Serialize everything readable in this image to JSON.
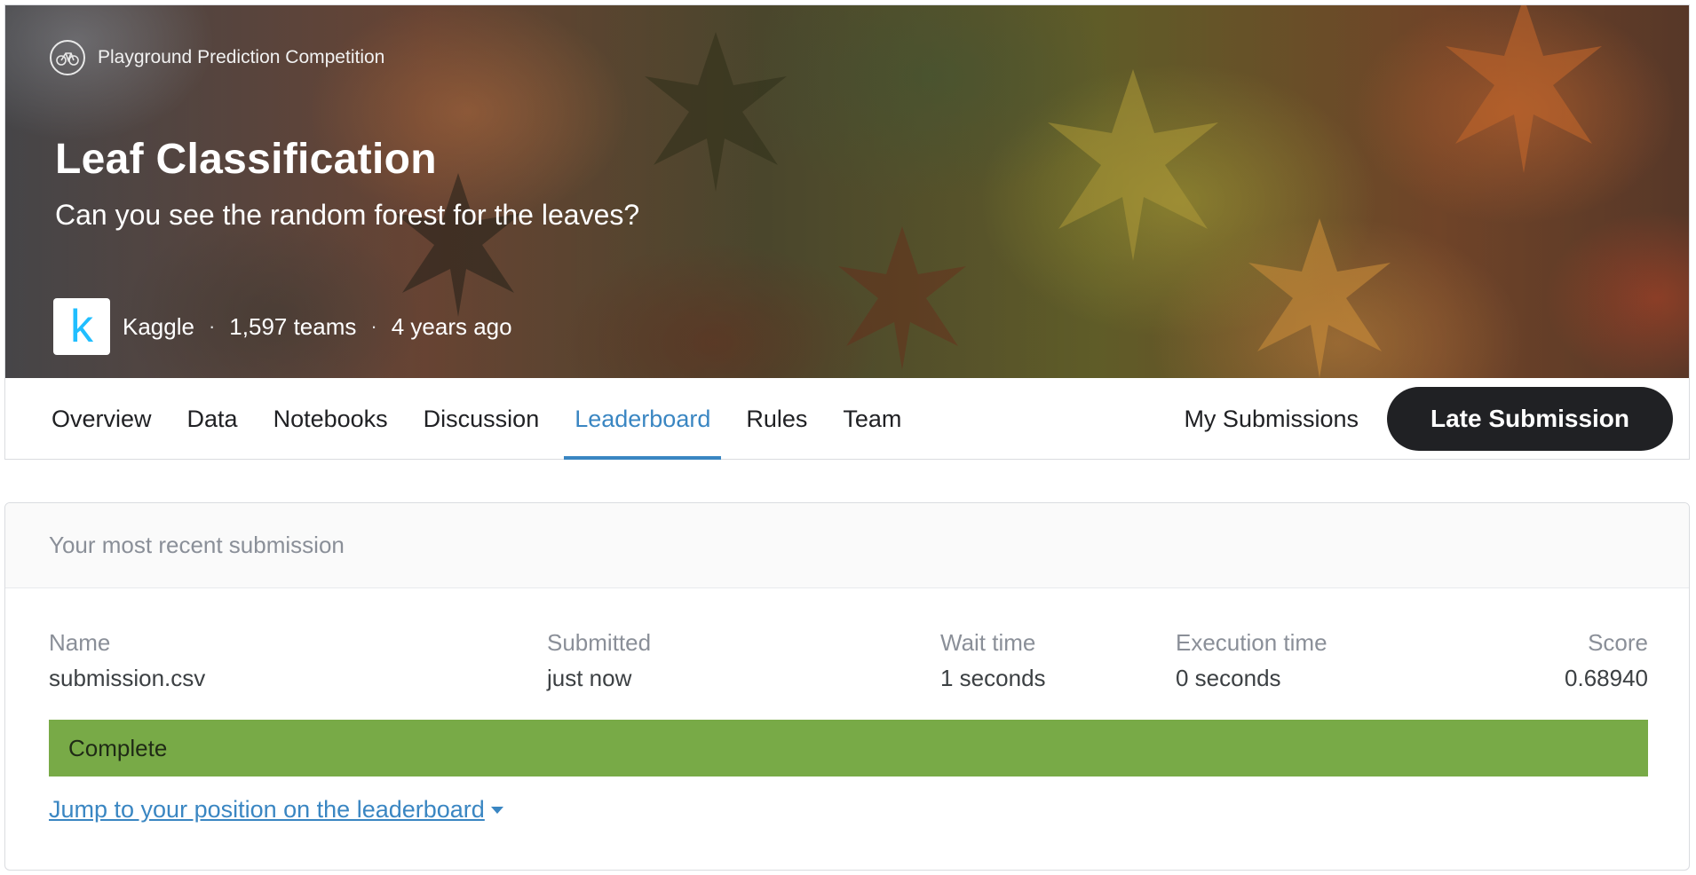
{
  "hero": {
    "competition_type": "Playground Prediction Competition",
    "competition_icon": "bicycle-icon",
    "title": "Leaf Classification",
    "subtitle": "Can you see the random forest for the leaves?",
    "host_logo_letter": "k",
    "host": "Kaggle",
    "teams": "1,597 teams",
    "age": "4 years ago",
    "separator": "·"
  },
  "tabs": {
    "items": [
      {
        "label": "Overview"
      },
      {
        "label": "Data"
      },
      {
        "label": "Notebooks"
      },
      {
        "label": "Discussion"
      },
      {
        "label": "Leaderboard",
        "active": true
      },
      {
        "label": "Rules"
      },
      {
        "label": "Team"
      }
    ],
    "my_submissions": "My Submissions",
    "late_submission": "Late Submission"
  },
  "submission": {
    "heading": "Your most recent submission",
    "columns": {
      "name_header": "Name",
      "name_value": "submission.csv",
      "submitted_header": "Submitted",
      "submitted_value": "just now",
      "wait_header": "Wait time",
      "wait_value": "1 seconds",
      "exec_header": "Execution time",
      "exec_value": "0 seconds",
      "score_header": "Score",
      "score_value": "0.68940"
    },
    "status": "Complete",
    "jump_link": "Jump to your position on the leaderboard"
  },
  "colors": {
    "accent": "#3a86c2",
    "status_complete": "#78aa47",
    "button_dark": "#202124",
    "kaggle_blue": "#20beff"
  }
}
